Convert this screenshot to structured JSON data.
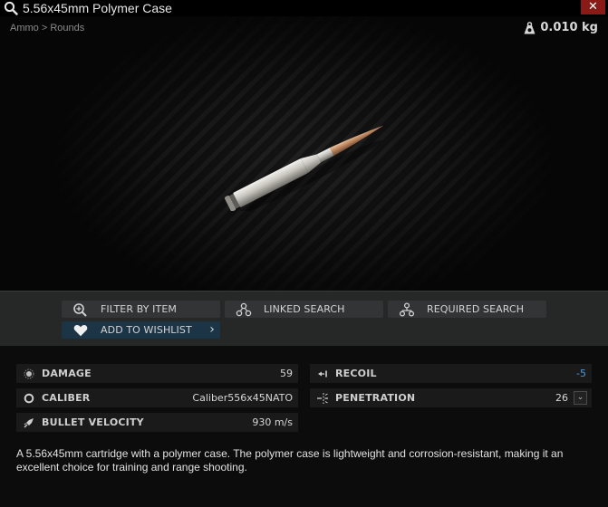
{
  "window": {
    "title": "5.56x45mm Polymer Case",
    "close_label": "✕"
  },
  "breadcrumb": {
    "category": "Ammo",
    "separator": " > ",
    "subcategory": "Rounds"
  },
  "weight": {
    "value": "0.010 kg",
    "icon": "weight-icon"
  },
  "item": {
    "name": "5.56x45mm Polymer Case",
    "image": "bullet-cartridge"
  },
  "actions": {
    "filter_label": "FILTER BY ITEM",
    "linked_label": "LINKED SEARCH",
    "required_label": "REQUIRED SEARCH",
    "wishlist_label": "ADD TO WISHLIST",
    "wishlist_chevron": "›"
  },
  "stats": {
    "damage": {
      "label": "DAMAGE",
      "value": "59"
    },
    "caliber": {
      "label": "CALIBER",
      "value": "Caliber556x45NATO"
    },
    "velocity": {
      "label": "BULLET VELOCITY",
      "value": "930 m/s"
    },
    "recoil": {
      "label": "RECOIL",
      "value": "-5",
      "color": "#4d9ad8"
    },
    "penetration": {
      "label": "PENETRATION",
      "value": "26",
      "dropdown": "⌄"
    }
  },
  "description": "A 5.56x45mm cartridge with a polymer case. The polymer case is lightweight and corrosion-resistant, making it an excellent choice for training and range shooting.",
  "colors": {
    "close": "#8a1a16",
    "wishlist": "#1c3546",
    "accent_blue": "#4d9ad8"
  }
}
